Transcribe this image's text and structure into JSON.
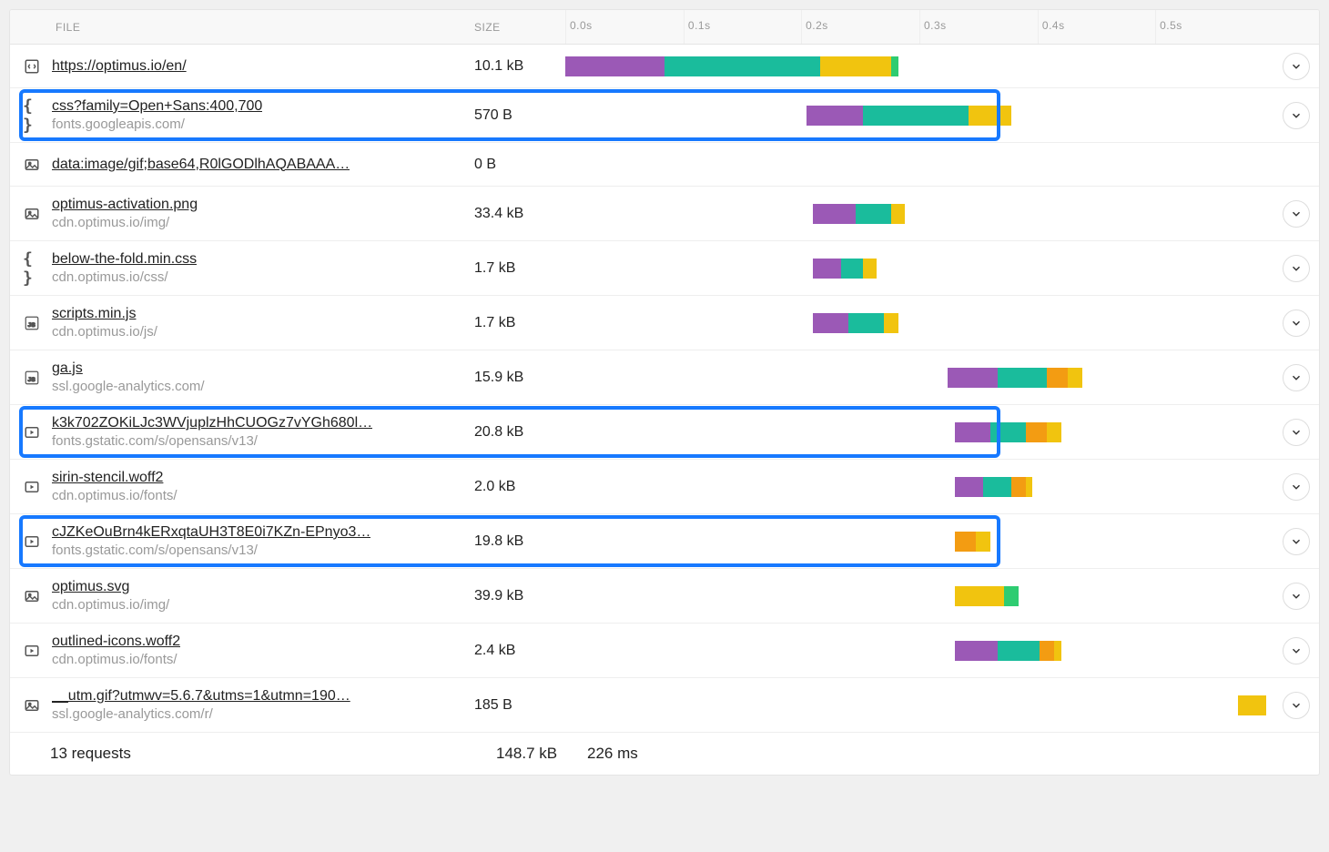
{
  "columns": {
    "file": "FILE",
    "size": "SIZE"
  },
  "ticks": [
    {
      "label": "0.0s",
      "pct": 0
    },
    {
      "label": "0.1s",
      "pct": 16.7
    },
    {
      "label": "0.2s",
      "pct": 33.3
    },
    {
      "label": "0.3s",
      "pct": 50.0
    },
    {
      "label": "0.4s",
      "pct": 66.7
    },
    {
      "label": "0.5s",
      "pct": 83.3
    }
  ],
  "rows": [
    {
      "icon": "code",
      "name": "https://optimus.io/en/",
      "host": "",
      "size": "10.1 kB",
      "highlight": false,
      "expand": true,
      "segs": [
        {
          "c": "purple",
          "l": 0,
          "w": 14
        },
        {
          "c": "teal",
          "l": 14,
          "w": 22
        },
        {
          "c": "yellow",
          "l": 36,
          "w": 10
        },
        {
          "c": "green",
          "l": 46,
          "w": 1
        }
      ]
    },
    {
      "icon": "braces",
      "name": "css?family=Open+Sans:400,700",
      "host": "fonts.googleapis.com/",
      "size": "570 B",
      "highlight": true,
      "expand": true,
      "segs": [
        {
          "c": "purple",
          "l": 34,
          "w": 8
        },
        {
          "c": "teal",
          "l": 42,
          "w": 15
        },
        {
          "c": "yellow",
          "l": 57,
          "w": 6
        }
      ]
    },
    {
      "icon": "image",
      "name": "data:image/gif;base64,R0lGODlhAQABAAA…",
      "host": "",
      "size": "0 B",
      "highlight": false,
      "expand": false,
      "segs": []
    },
    {
      "icon": "image",
      "name": "optimus-activation.png",
      "host": "cdn.optimus.io/img/",
      "size": "33.4 kB",
      "highlight": false,
      "expand": true,
      "segs": [
        {
          "c": "purple",
          "l": 35,
          "w": 6
        },
        {
          "c": "teal",
          "l": 41,
          "w": 5
        },
        {
          "c": "yellow",
          "l": 46,
          "w": 2
        }
      ]
    },
    {
      "icon": "braces",
      "name": "below-the-fold.min.css",
      "host": "cdn.optimus.io/css/",
      "size": "1.7 kB",
      "highlight": false,
      "expand": true,
      "segs": [
        {
          "c": "purple",
          "l": 35,
          "w": 4
        },
        {
          "c": "teal",
          "l": 39,
          "w": 3
        },
        {
          "c": "yellow",
          "l": 42,
          "w": 2
        }
      ]
    },
    {
      "icon": "js",
      "name": "scripts.min.js",
      "host": "cdn.optimus.io/js/",
      "size": "1.7 kB",
      "highlight": false,
      "expand": true,
      "segs": [
        {
          "c": "purple",
          "l": 35,
          "w": 5
        },
        {
          "c": "teal",
          "l": 40,
          "w": 5
        },
        {
          "c": "yellow",
          "l": 45,
          "w": 2
        }
      ]
    },
    {
      "icon": "js",
      "name": "ga.js",
      "host": "ssl.google-analytics.com/",
      "size": "15.9 kB",
      "highlight": false,
      "expand": true,
      "segs": [
        {
          "c": "purple",
          "l": 54,
          "w": 7
        },
        {
          "c": "teal",
          "l": 61,
          "w": 7
        },
        {
          "c": "orange",
          "l": 68,
          "w": 3
        },
        {
          "c": "yellow",
          "l": 71,
          "w": 2
        }
      ]
    },
    {
      "icon": "media",
      "name": "k3k702ZOKiLJc3WVjuplzHhCUOGz7vYGh680l…",
      "host": "fonts.gstatic.com/s/opensans/v13/",
      "size": "20.8 kB",
      "highlight": true,
      "expand": true,
      "segs": [
        {
          "c": "purple",
          "l": 55,
          "w": 5
        },
        {
          "c": "teal",
          "l": 60,
          "w": 5
        },
        {
          "c": "orange",
          "l": 65,
          "w": 3
        },
        {
          "c": "yellow",
          "l": 68,
          "w": 2
        }
      ]
    },
    {
      "icon": "media",
      "name": "sirin-stencil.woff2",
      "host": "cdn.optimus.io/fonts/",
      "size": "2.0 kB",
      "highlight": false,
      "expand": true,
      "segs": [
        {
          "c": "purple",
          "l": 55,
          "w": 4
        },
        {
          "c": "teal",
          "l": 59,
          "w": 4
        },
        {
          "c": "orange",
          "l": 63,
          "w": 2
        },
        {
          "c": "yellow",
          "l": 65,
          "w": 1
        }
      ]
    },
    {
      "icon": "media",
      "name": "cJZKeOuBrn4kERxqtaUH3T8E0i7KZn-EPnyo3…",
      "host": "fonts.gstatic.com/s/opensans/v13/",
      "size": "19.8 kB",
      "highlight": true,
      "expand": true,
      "segs": [
        {
          "c": "orange",
          "l": 55,
          "w": 3
        },
        {
          "c": "yellow",
          "l": 58,
          "w": 2
        }
      ]
    },
    {
      "icon": "image",
      "name": "optimus.svg",
      "host": "cdn.optimus.io/img/",
      "size": "39.9 kB",
      "highlight": false,
      "expand": true,
      "segs": [
        {
          "c": "yellow",
          "l": 55,
          "w": 7
        },
        {
          "c": "green",
          "l": 62,
          "w": 2
        }
      ]
    },
    {
      "icon": "media",
      "name": "outlined-icons.woff2",
      "host": "cdn.optimus.io/fonts/",
      "size": "2.4 kB",
      "highlight": false,
      "expand": true,
      "segs": [
        {
          "c": "purple",
          "l": 55,
          "w": 6
        },
        {
          "c": "teal",
          "l": 61,
          "w": 6
        },
        {
          "c": "orange",
          "l": 67,
          "w": 2
        },
        {
          "c": "yellow",
          "l": 69,
          "w": 1
        }
      ]
    },
    {
      "icon": "image",
      "name": "__utm.gif?utmwv=5.6.7&utms=1&utmn=190…",
      "host": "ssl.google-analytics.com/r/",
      "size": "185 B",
      "highlight": false,
      "expand": true,
      "segs": [
        {
          "c": "yellow",
          "l": 95,
          "w": 4
        }
      ]
    }
  ],
  "footer": {
    "requests": "13 requests",
    "size": "148.7 kB",
    "time": "226 ms"
  }
}
